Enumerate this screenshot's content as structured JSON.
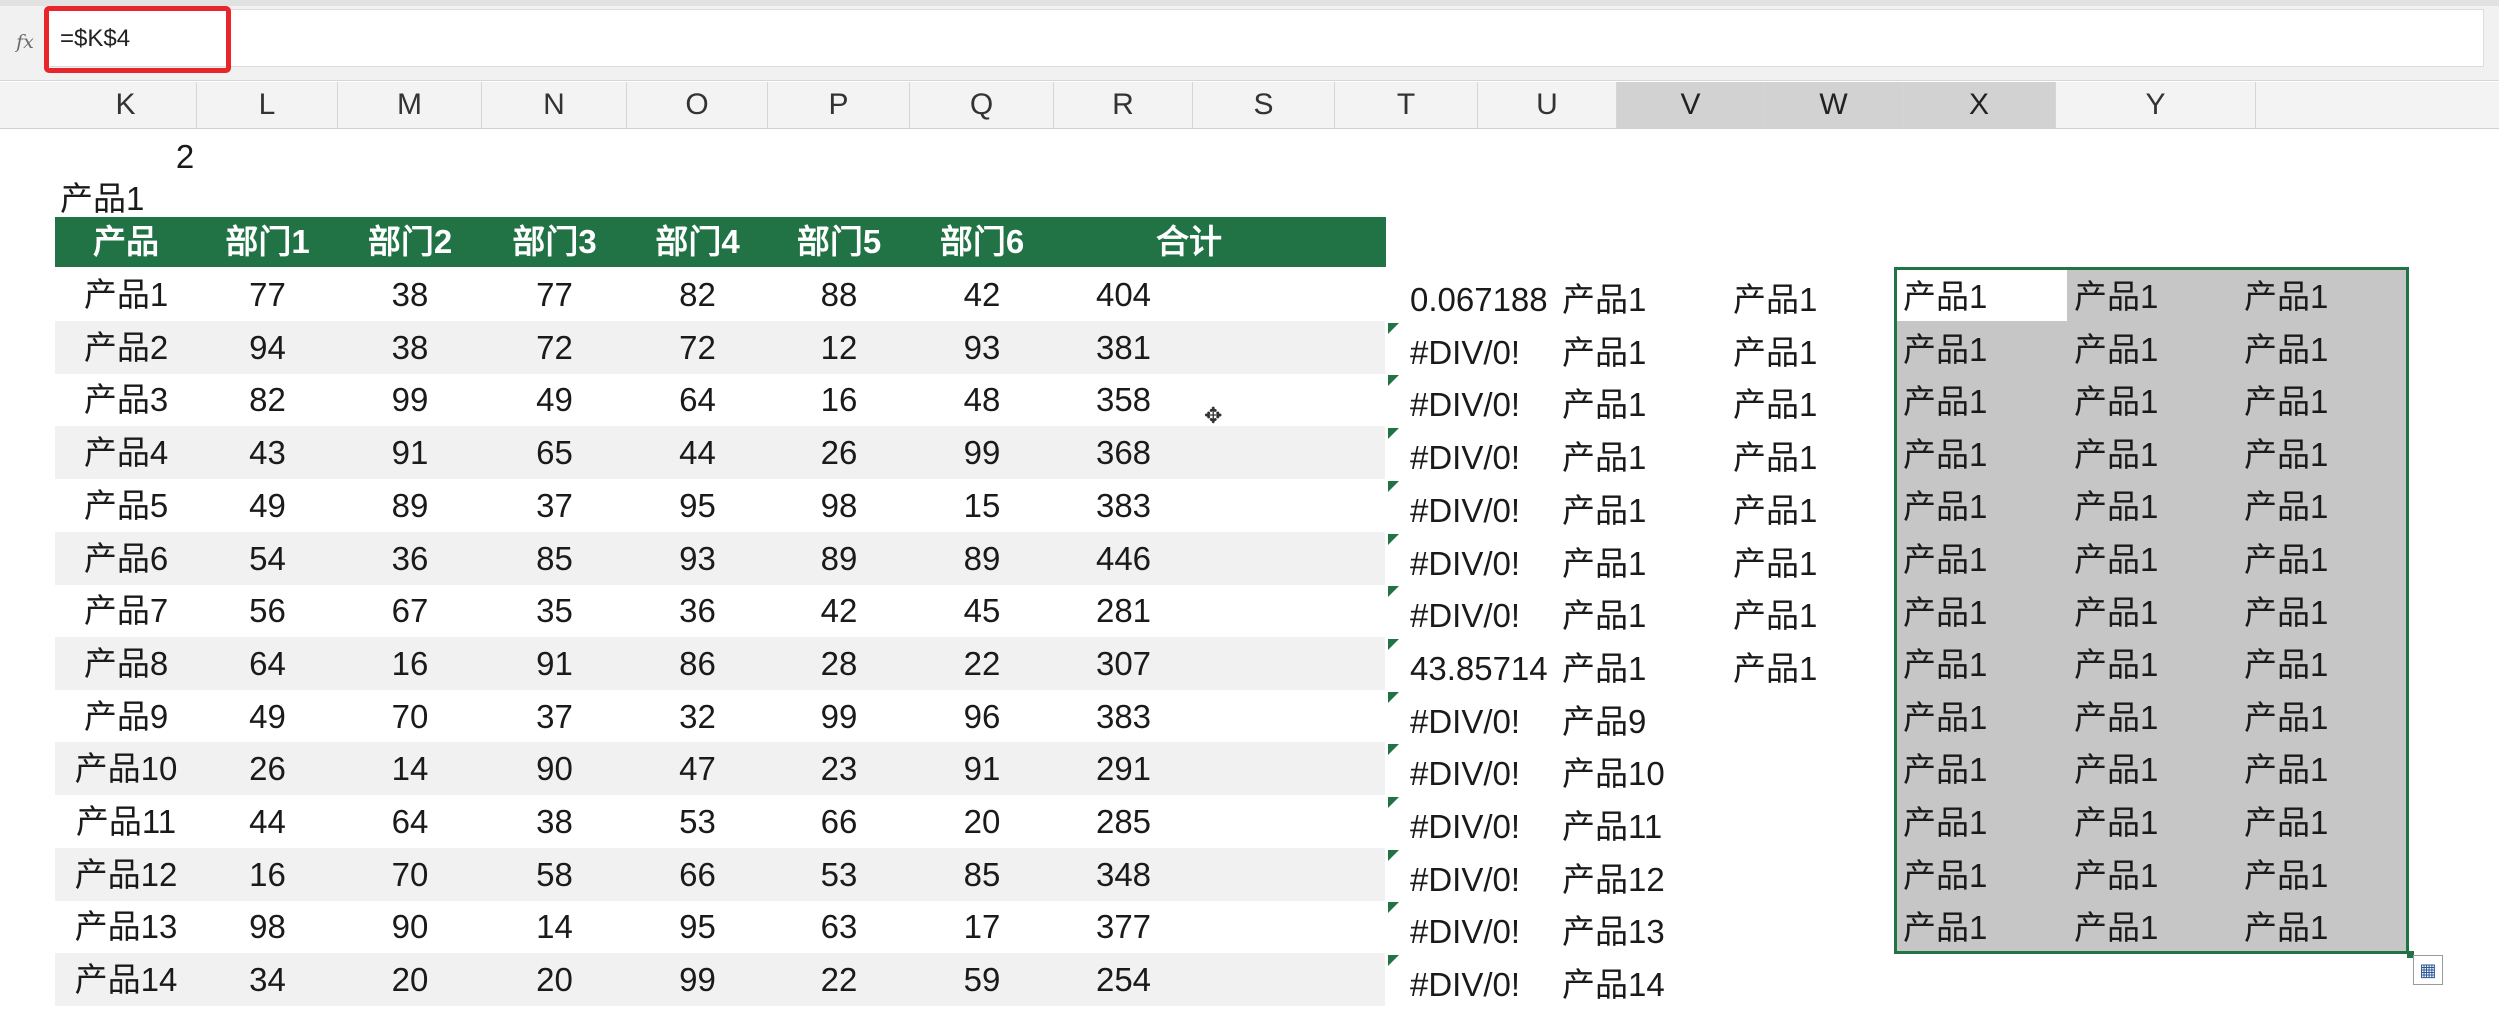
{
  "formula_bar": {
    "fx_icon": "fx",
    "formula": "=$K$4"
  },
  "columns": [
    {
      "label": "K",
      "selected": false
    },
    {
      "label": "L",
      "selected": false
    },
    {
      "label": "M",
      "selected": false
    },
    {
      "label": "N",
      "selected": false
    },
    {
      "label": "O",
      "selected": false
    },
    {
      "label": "P",
      "selected": false
    },
    {
      "label": "Q",
      "selected": false
    },
    {
      "label": "R",
      "selected": false
    },
    {
      "label": "S",
      "selected": false
    },
    {
      "label": "T",
      "selected": false
    },
    {
      "label": "U",
      "selected": false
    },
    {
      "label": "V",
      "selected": true
    },
    {
      "label": "W",
      "selected": true
    },
    {
      "label": "X",
      "selected": true
    },
    {
      "label": "Y",
      "selected": false
    }
  ],
  "sheet": {
    "cell_number": "2",
    "cell_label": "产品1",
    "table_headers": [
      "产品",
      "部门1",
      "部门2",
      "部门3",
      "部门4",
      "部门5",
      "部门6",
      "合计"
    ],
    "rows": [
      [
        "产品1",
        "77",
        "38",
        "77",
        "82",
        "88",
        "42",
        "404"
      ],
      [
        "产品2",
        "94",
        "38",
        "72",
        "72",
        "12",
        "93",
        "381"
      ],
      [
        "产品3",
        "82",
        "99",
        "49",
        "64",
        "16",
        "48",
        "358"
      ],
      [
        "产品4",
        "43",
        "91",
        "65",
        "44",
        "26",
        "99",
        "368"
      ],
      [
        "产品5",
        "49",
        "89",
        "37",
        "95",
        "98",
        "15",
        "383"
      ],
      [
        "产品6",
        "54",
        "36",
        "85",
        "93",
        "89",
        "89",
        "446"
      ],
      [
        "产品7",
        "56",
        "67",
        "35",
        "36",
        "42",
        "45",
        "281"
      ],
      [
        "产品8",
        "64",
        "16",
        "91",
        "86",
        "28",
        "22",
        "307"
      ],
      [
        "产品9",
        "49",
        "70",
        "37",
        "32",
        "99",
        "96",
        "383"
      ],
      [
        "产品10",
        "26",
        "14",
        "90",
        "47",
        "23",
        "91",
        "291"
      ],
      [
        "产品11",
        "44",
        "64",
        "38",
        "53",
        "66",
        "20",
        "285"
      ],
      [
        "产品12",
        "16",
        "70",
        "58",
        "66",
        "53",
        "85",
        "348"
      ],
      [
        "产品13",
        "98",
        "90",
        "14",
        "95",
        "63",
        "17",
        "377"
      ],
      [
        "产品14",
        "34",
        "20",
        "20",
        "99",
        "22",
        "59",
        "254"
      ]
    ],
    "col_s": [
      "0.067188",
      "#DIV/0!",
      "#DIV/0!",
      "#DIV/0!",
      "#DIV/0!",
      "#DIV/0!",
      "#DIV/0!",
      "43.85714",
      "#DIV/0!",
      "#DIV/0!",
      "#DIV/0!",
      "#DIV/0!",
      "#DIV/0!",
      "#DIV/0!"
    ],
    "col_t": [
      "产品1",
      "产品1",
      "产品1",
      "产品1",
      "产品1",
      "产品1",
      "产品1",
      "产品1",
      "产品9",
      "产品10",
      "产品11",
      "产品12",
      "产品13",
      "产品14"
    ],
    "col_u": [
      "产品1",
      "产品1",
      "产品1",
      "产品1",
      "产品1",
      "产品1",
      "产品1",
      "产品1"
    ],
    "selection_rows": 13,
    "selection_value": "产品1"
  },
  "colors": {
    "header_green": "#217346",
    "formula_highlight": "#e8252b",
    "selection_fill": "#c6c6c6"
  },
  "icons": {
    "cursor": "move-cursor-icon",
    "quick_analysis": "quick-analysis-icon"
  }
}
